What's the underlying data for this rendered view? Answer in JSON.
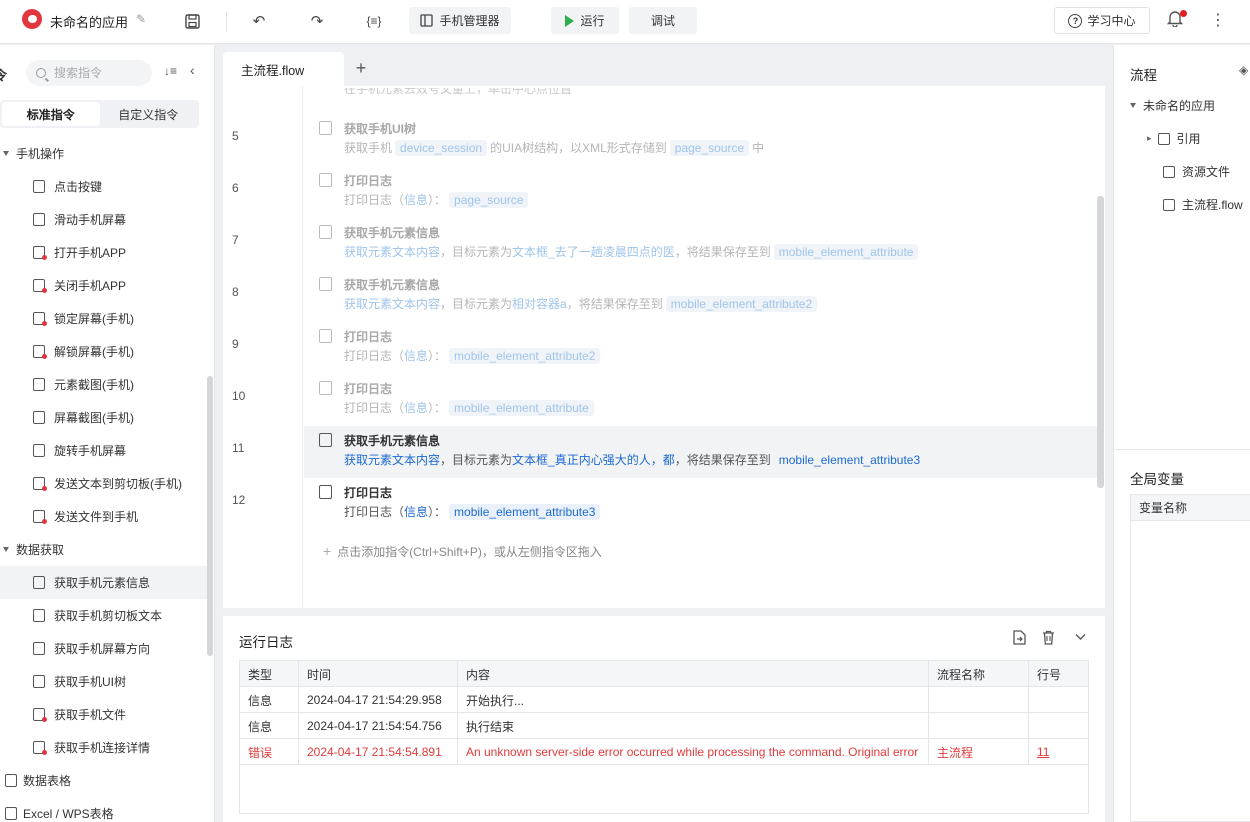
{
  "app": {
    "title": "未命名的应用"
  },
  "toolbar": {
    "phone_manager": "手机管理器",
    "run": "运行",
    "debug": "调试",
    "learn": "学习中心",
    "var_icon": "{≡}"
  },
  "left": {
    "header_char": "令",
    "search_placeholder": "搜索指令",
    "tab_standard": "标准指令",
    "tab_custom": "自定义指令",
    "group_phone": "手机操作",
    "phone_items": [
      "点击按键",
      "滑动手机屏幕",
      "打开手机APP",
      "关闭手机APP",
      "锁定屏幕(手机)",
      "解锁屏幕(手机)",
      "元素截图(手机)",
      "屏幕截图(手机)",
      "旋转手机屏幕",
      "发送文本到剪切板(手机)",
      "发送文件到手机"
    ],
    "group_data": "数据获取",
    "data_items": [
      "获取手机元素信息",
      "获取手机剪切板文本",
      "获取手机屏幕方向",
      "获取手机UI树",
      "获取手机文件",
      "获取手机连接详情"
    ],
    "group_table": "数据表格",
    "group_excel": "Excel / WPS表格"
  },
  "editor": {
    "tab": "主流程.flow",
    "top_cut": "在手机元素去效号文童上，单击中心点位置",
    "steps": [
      {
        "no": "5",
        "title": "获取手机UI树",
        "d1": "获取手机",
        "c1": "device_session",
        "d2": "的UIA树结构，以XML形式存储到",
        "c2": "page_source",
        "d3": "中"
      },
      {
        "no": "6",
        "title": "打印日志",
        "d1": "打印日志（",
        "k1": "信息",
        "d2": "）：",
        "c1": "page_source"
      },
      {
        "no": "7",
        "title": "获取手机元素信息",
        "k1": "获取元素文本内容",
        "d1": "，目标元素为",
        "k2": "文本框_去了一趟凌晨四点的医",
        "d2": "，将结果保存至到",
        "c1": "mobile_element_attribute"
      },
      {
        "no": "8",
        "title": "获取手机元素信息",
        "k1": "获取元素文本内容",
        "d1": "，目标元素为",
        "k2": "相对容器a",
        "d2": "，将结果保存至到",
        "c1": "mobile_element_attribute2"
      },
      {
        "no": "9",
        "title": "打印日志",
        "d1": "打印日志（",
        "k1": "信息",
        "d2": "）：",
        "c1": "mobile_element_attribute2"
      },
      {
        "no": "10",
        "title": "打印日志",
        "d1": "打印日志（",
        "k1": "信息",
        "d2": "）：",
        "c1": "mobile_element_attribute"
      },
      {
        "no": "11",
        "title": "获取手机元素信息",
        "k1": "获取元素文本内容",
        "d1": "，目标元素为",
        "k2": "文本框_真正内心强大的人，都",
        "d2": "，将结果保存至到",
        "c1": "mobile_element_attribute3"
      },
      {
        "no": "12",
        "title": "打印日志",
        "d1": "打印日志（",
        "k1": "信息",
        "d2": "）：",
        "c1": "mobile_element_attribute3"
      }
    ],
    "add_hint": "点击添加指令(Ctrl+Shift+P)，或从左侧指令区拖入"
  },
  "log": {
    "title": "运行日志",
    "headers": [
      "类型",
      "时间",
      "内容",
      "流程名称",
      "行号"
    ],
    "rows": [
      [
        "信息",
        "2024-04-17 21:54:29.958",
        "开始执行...",
        "",
        ""
      ],
      [
        "信息",
        "2024-04-17 21:54:54.756",
        "执行结束",
        "",
        ""
      ],
      [
        "错误",
        "2024-04-17 21:54:54.891",
        "An unknown server-side error occurred while processing the command. Original error",
        "主流程",
        "11"
      ]
    ]
  },
  "right": {
    "title": "流程",
    "root": "未命名的应用",
    "ref": "引用",
    "resources": "资源文件",
    "main_flow": "主流程.flow",
    "vars_title": "全局变量",
    "var_name_header": "变量名称"
  },
  "colors": {
    "accent": "#1b6ad1",
    "error": "#e23b3b",
    "run": "#2fae4d",
    "brand": "#e2363f"
  }
}
